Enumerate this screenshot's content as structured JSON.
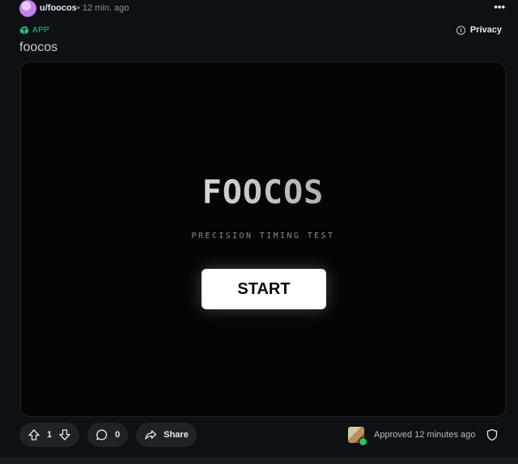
{
  "post": {
    "username": "u/foocos",
    "separator": "•",
    "time_ago": "12 min. ago",
    "more_label": "•••",
    "app_label": "APP",
    "privacy_label": "Privacy",
    "title": "foocos"
  },
  "game": {
    "title": "FOOCOS",
    "subtitle": "PRECISION TIMING TEST",
    "start_label": "START"
  },
  "actions": {
    "vote_count": "1",
    "comment_count": "0",
    "share_label": "Share"
  },
  "moderation": {
    "approved_text": "Approved 12 minutes ago"
  },
  "colors": {
    "background": "#0e1113",
    "accent_app": "#2fbf8f",
    "approved_check": "#29c45d"
  },
  "icons": [
    "upvote-icon",
    "downvote-icon",
    "comment-icon",
    "share-icon",
    "info-icon",
    "shield-icon",
    "app-icon"
  ]
}
